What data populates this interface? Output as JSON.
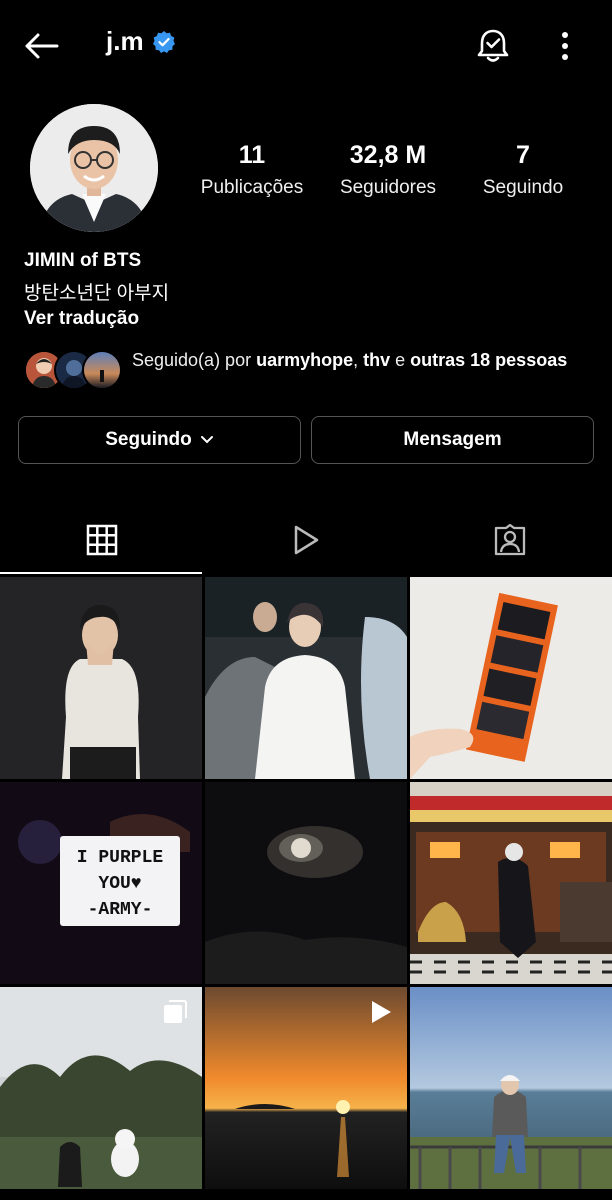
{
  "header": {
    "username": "j.m",
    "verified": true,
    "icons": {
      "back": "arrow-left-icon",
      "notifications": "bell-check-icon",
      "more": "more-vertical-icon"
    }
  },
  "profile": {
    "stats": [
      {
        "value": "11",
        "label": "Publicações"
      },
      {
        "value": "32,8 M",
        "label": "Seguidores"
      },
      {
        "value": "7",
        "label": "Seguindo"
      }
    ],
    "bio": {
      "name": "JIMIN of BTS",
      "text": "방탄소년단 아부지",
      "translate_link": "Ver tradução"
    },
    "followed_by": {
      "prefix": "Seguido(a) por ",
      "user1": "uarmyhope",
      "sep": ", ",
      "user2": "thv",
      "conj": " e ",
      "others": "outras 18 pessoas"
    }
  },
  "actions": {
    "following_label": "Seguindo",
    "message_label": "Mensagem"
  },
  "tabs": [
    {
      "name": "posts",
      "icon": "grid-icon",
      "active": true
    },
    {
      "name": "reels",
      "icon": "play-icon",
      "active": false
    },
    {
      "name": "tagged",
      "icon": "tagged-person-icon",
      "active": false
    }
  ],
  "grid": {
    "photo3_text": [
      "I PURPLE",
      "YOU♥",
      "-ARMY-"
    ],
    "badges": {
      "post7": "carousel-icon",
      "post8": "reel-play-icon"
    }
  },
  "colors": {
    "verified": "#3897f0",
    "background": "#000000",
    "button_border": "#555555"
  }
}
